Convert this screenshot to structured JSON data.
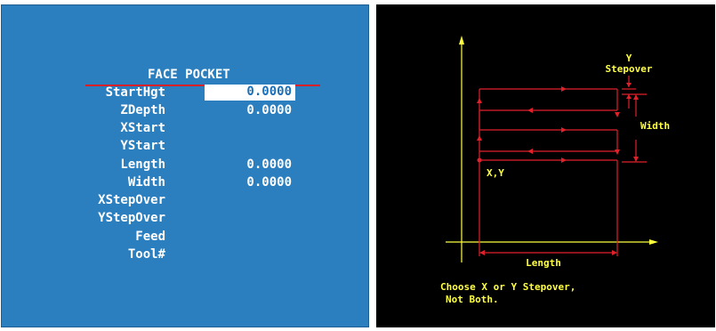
{
  "form": {
    "title": "FACE POCKET",
    "fields": [
      {
        "label": "StartHgt",
        "value": "0.0000"
      },
      {
        "label": "ZDepth",
        "value": "0.0000"
      },
      {
        "label": "XStart",
        "value": ""
      },
      {
        "label": "YStart",
        "value": ""
      },
      {
        "label": "Length",
        "value": "0.0000"
      },
      {
        "label": "Width",
        "value": "0.0000"
      },
      {
        "label": "XStepOver",
        "value": ""
      },
      {
        "label": "YStepOver",
        "value": ""
      },
      {
        "label": "Feed",
        "value": ""
      },
      {
        "label": "Tool#",
        "value": ""
      }
    ]
  },
  "diagram": {
    "y_stepover_line1": "Y",
    "y_stepover_line2": "Stepover",
    "width_label": "Width",
    "xy_label": "X,Y",
    "length_label": "Length",
    "note_line1": "Choose X or Y Stepover,",
    "note_line2": "Not Both.",
    "colors": {
      "lines": "#e0202a",
      "text": "#ffff40",
      "axes": "#ffff40"
    }
  }
}
